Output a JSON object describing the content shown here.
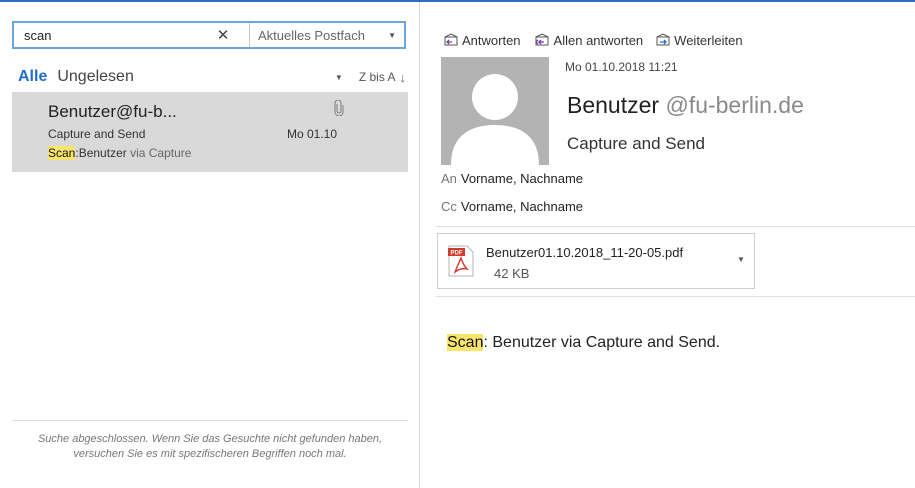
{
  "search": {
    "value": "scan",
    "clear_icon": "close-icon",
    "scope": "Aktuelles Postfach"
  },
  "filters": {
    "all": "Alle",
    "unread": "Ungelesen",
    "sort": "Z bis A",
    "sort_icon": "arrow-down-icon"
  },
  "mail_list": [
    {
      "sender": "Benutzer@fu-b...",
      "subject": "Capture and Send",
      "date": "Mo 01.10",
      "preview_highlight": "Scan",
      "preview_colon": ":",
      "preview_name": "Benutzer",
      "preview_rest": " via Capture",
      "has_attachment": true
    }
  ],
  "search_status": "Suche abgeschlossen. Wenn Sie das Gesuchte nicht gefunden haben, versuchen Sie es mit spezifischeren Begriffen noch mal.",
  "toolbar": {
    "reply": "Antworten",
    "reply_all": "Allen antworten",
    "forward": "Weiterleiten"
  },
  "message": {
    "date": "Mo 01.10.2018 11:21",
    "sender_name": "Benutzer",
    "sender_domain": "@fu-berlin.de",
    "subject": "Capture and Send",
    "to_prefix": "An",
    "to": "Vorname, Nachname",
    "cc_prefix": "Cc",
    "cc": "Vorname, Nachname",
    "attachment": {
      "name": "Benutzer01.10.2018_11-20-05.pdf",
      "size": "42 KB",
      "icon": "pdf-icon",
      "badge": "PDF"
    },
    "body_highlight": "Scan",
    "body_colon": ":",
    "body_rest": " Benutzer via Capture and Send."
  },
  "colors": {
    "accent": "#1f6fc8",
    "highlight": "#fbe46a",
    "selected_item": "#d9d9d9",
    "avatar": "#b3b3b3"
  }
}
